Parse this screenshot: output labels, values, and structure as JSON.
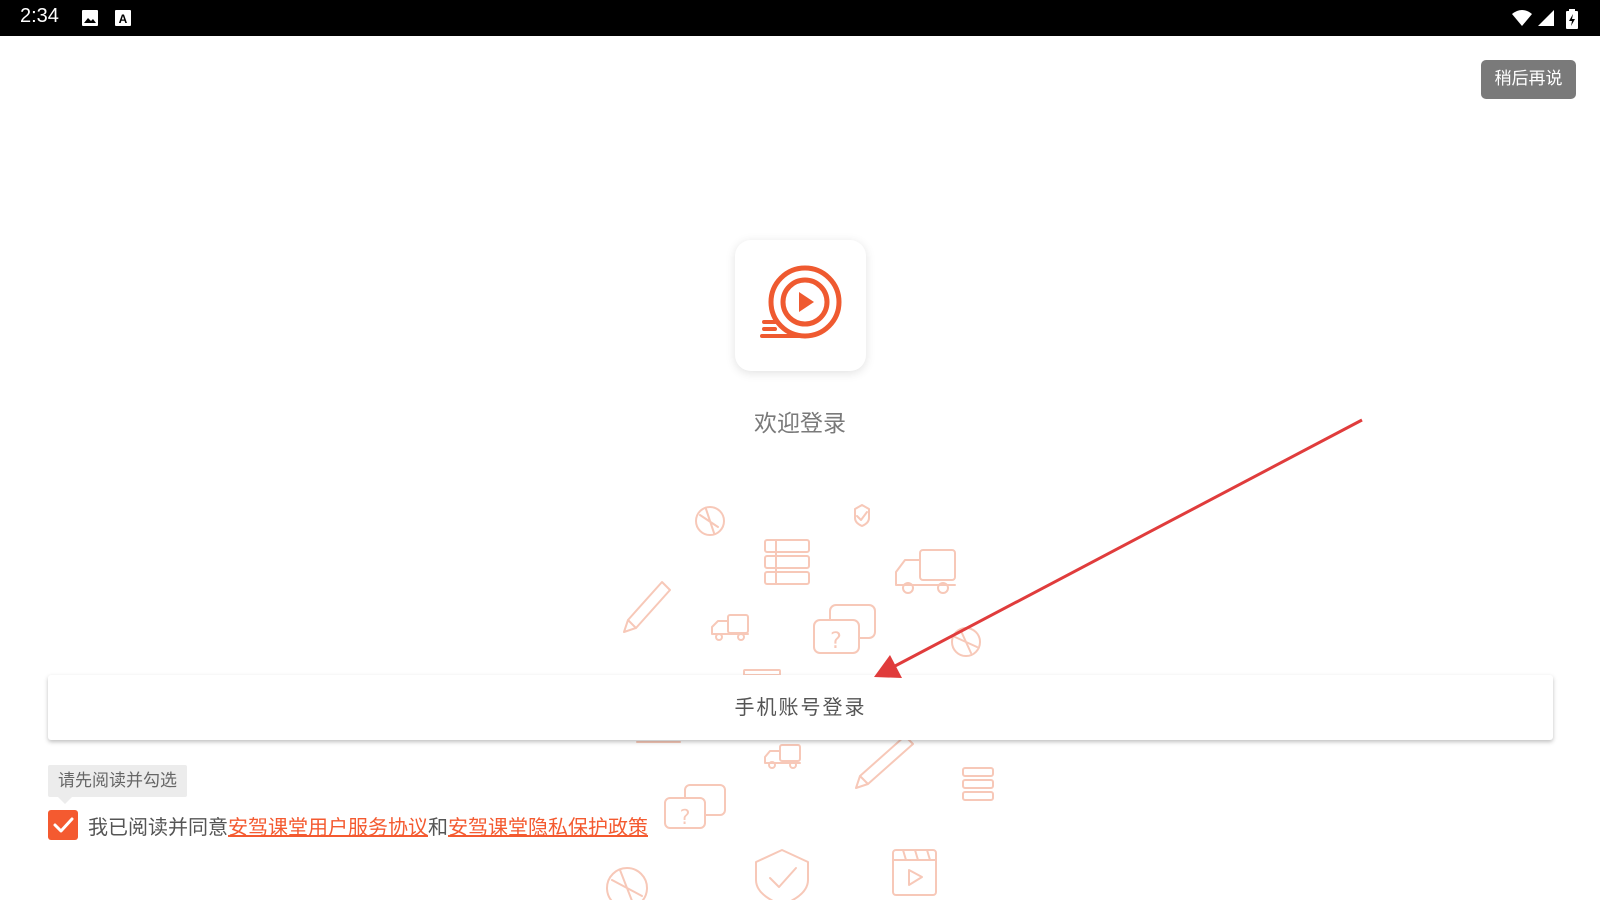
{
  "status_bar": {
    "time": "2:34",
    "left_icons": [
      "image-icon",
      "text-a-icon"
    ],
    "right_icons": [
      "wifi-icon",
      "cell-signal-icon",
      "battery-icon"
    ]
  },
  "skip_button": {
    "label": "稍后再说"
  },
  "logo": {
    "icon": "play-circle-motion-icon",
    "color": "#ef5a30"
  },
  "welcome_title": "欢迎登录",
  "login_button": {
    "label": "手机账号登录"
  },
  "agreement": {
    "tooltip": "请先阅读并勾选",
    "checked": true,
    "prefix": "我已阅读并同意",
    "terms_link": "安驾课堂用户服务协议",
    "joiner": "和",
    "privacy_link": "安驾课堂隐私保护政策"
  },
  "colors": {
    "accent": "#f45a30",
    "annotation_arrow": "#e03c3c",
    "button_grey": "#7a7a7a"
  }
}
